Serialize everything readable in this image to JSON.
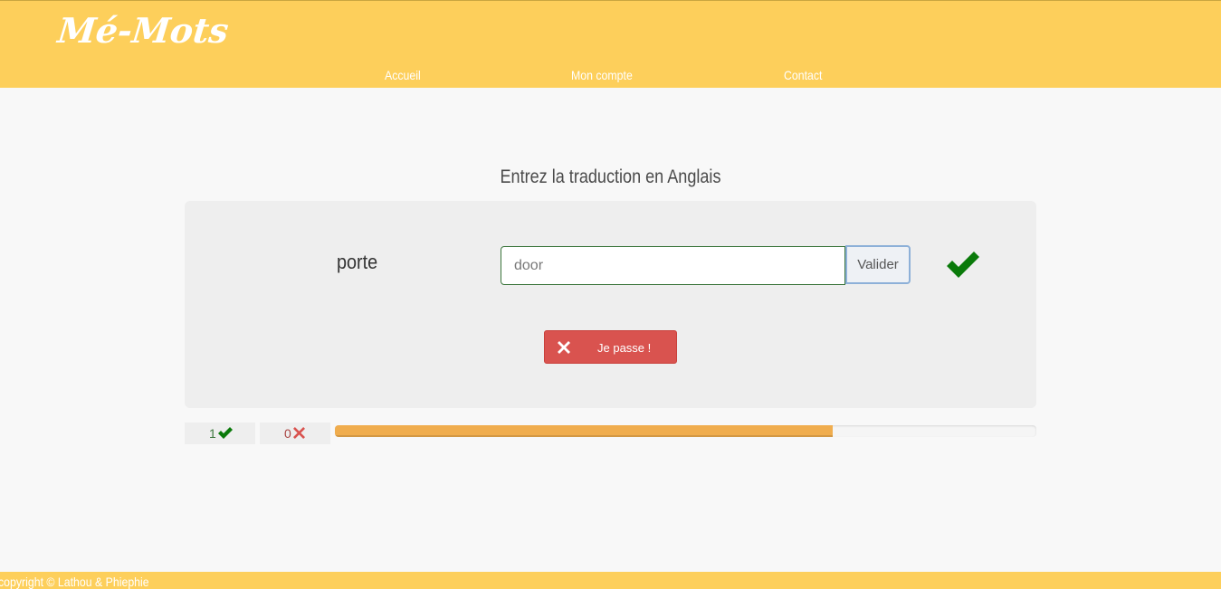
{
  "header": {
    "logo": "Mé-Mots",
    "nav": [
      {
        "label": "Accueil"
      },
      {
        "label": "Mon compte"
      },
      {
        "label": "Contact"
      }
    ]
  },
  "quiz": {
    "instruction": "Entrez la traduction en Anglais",
    "word": "porte",
    "answer_value": "door",
    "validate_label": "Valider",
    "skip_label": "Je passe !",
    "result_icon": "check-icon"
  },
  "score": {
    "correct": "1",
    "wrong": "0",
    "progress_percent": 71
  },
  "colors": {
    "header_bg": "#fdcf5b",
    "success": "#3c763d",
    "danger": "#d9534f",
    "progress": "#f0ad4e"
  },
  "footer": {
    "text": "copyright © Lathou & Phiephie"
  }
}
